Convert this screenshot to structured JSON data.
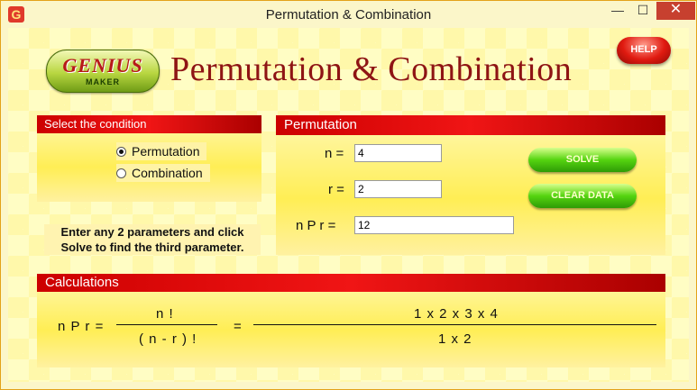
{
  "window": {
    "title": "Permutation & Combination",
    "icon_glyph": "G",
    "controls": {
      "minimize": "—",
      "maximize": "☐",
      "close": "✕"
    }
  },
  "header": {
    "logo_main": "GENIUS",
    "logo_sub": "MAKER",
    "heading": "Permutation & Combination",
    "help_label": "HELP"
  },
  "condition_panel": {
    "title": "Select the condition",
    "options": [
      {
        "label": "Permutation",
        "selected": true
      },
      {
        "label": "Combination",
        "selected": false
      }
    ]
  },
  "hint": {
    "line1": "Enter any 2 parameters and click",
    "line2": "Solve to find the third parameter."
  },
  "permutation_panel": {
    "title": "Permutation",
    "n_label": "n  =",
    "n_value": "4",
    "r_label": "r  =",
    "r_value": "2",
    "npr_label": "n P r  =",
    "npr_value": "12",
    "solve_label": "SOLVE",
    "clear_label": "CLEAR DATA"
  },
  "calculations": {
    "title": "Calculations",
    "lhs": "n P r  =",
    "formula_numerator": "n !",
    "formula_denominator": "( n - r ) !",
    "equals": "=",
    "result_numerator": "1 x 2 x 3 x 4",
    "result_denominator": "1 x 2"
  },
  "colors": {
    "panel_header": "#e00000",
    "button_green": "#55d410",
    "heading_red": "#8e1414"
  }
}
